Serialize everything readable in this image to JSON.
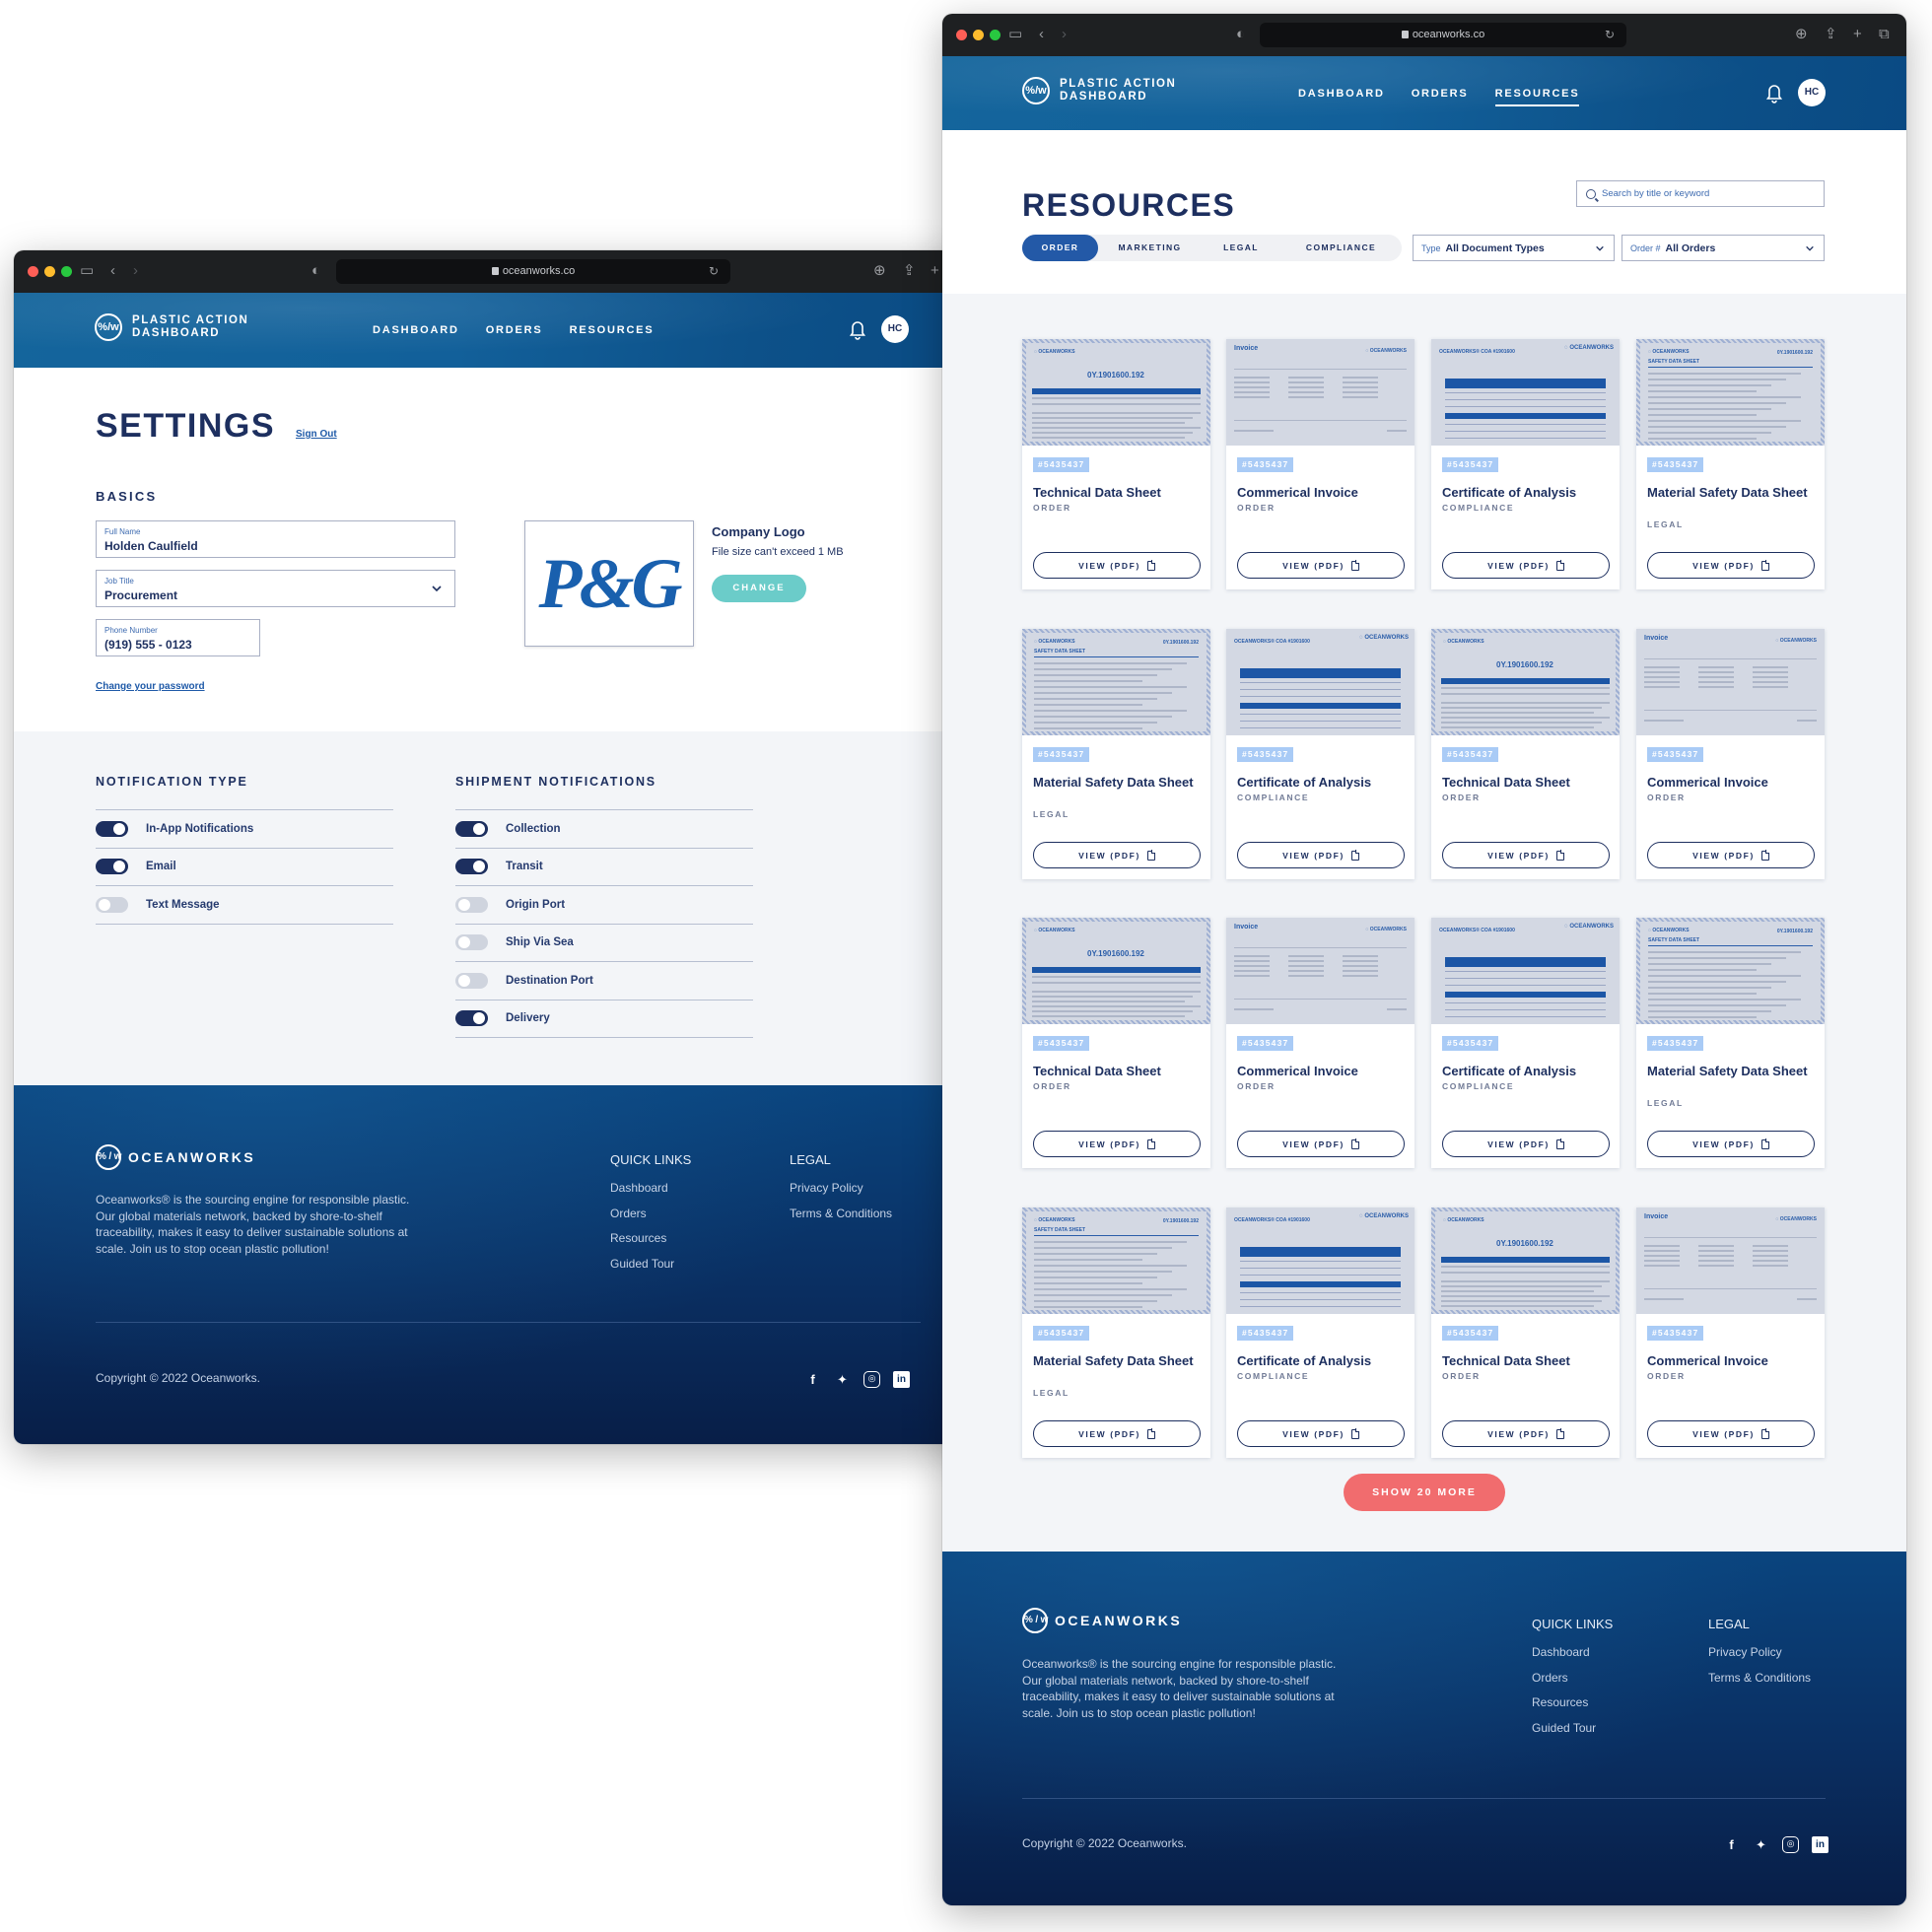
{
  "browser": {
    "url": "oceanworks.co"
  },
  "site": {
    "brand_mark": "%/w",
    "brand_title": "PLASTIC ACTION DASHBOARD",
    "nav": [
      {
        "label": "DASHBOARD"
      },
      {
        "label": "ORDERS"
      },
      {
        "label": "RESOURCES"
      }
    ],
    "avatar_initials": "HC"
  },
  "settings": {
    "title": "SETTINGS",
    "sign_out": "Sign Out",
    "basics_heading": "BASICS",
    "full_name": {
      "label": "Full Name",
      "value": "Holden Caulfield"
    },
    "job_title": {
      "label": "Job Title",
      "value": "Procurement"
    },
    "phone": {
      "label": "Phone Number",
      "value": "(919) 555 - 0123"
    },
    "change_password": "Change your password",
    "company_logo": {
      "title": "Company Logo",
      "note": "File size can't exceed 1 MB",
      "logo_text": "P&G",
      "change_label": "CHANGE"
    },
    "notification_type": {
      "heading": "NOTIFICATION TYPE",
      "items": [
        {
          "label": "In-App Notifications",
          "on": true
        },
        {
          "label": "Email",
          "on": true
        },
        {
          "label": "Text Message",
          "on": false
        }
      ]
    },
    "shipment_notifications": {
      "heading": "SHIPMENT  NOTIFICATIONS",
      "items": [
        {
          "label": "Collection",
          "on": true
        },
        {
          "label": "Transit",
          "on": true
        },
        {
          "label": "Origin Port",
          "on": false
        },
        {
          "label": "Ship Via Sea",
          "on": false
        },
        {
          "label": "Destination Port",
          "on": false
        },
        {
          "label": "Delivery",
          "on": true
        }
      ]
    }
  },
  "resources": {
    "title": "RESOURCES",
    "search_placeholder": "Search by title or keyword",
    "tabs": [
      {
        "label": "ORDER",
        "active": true
      },
      {
        "label": "MARKETING",
        "active": false
      },
      {
        "label": "LEGAL",
        "active": false
      },
      {
        "label": "COMPLIANCE",
        "active": false
      }
    ],
    "type_filter": {
      "key": "Type",
      "value": "All Document Types"
    },
    "order_filter": {
      "key": "Order #",
      "value": "All Orders"
    },
    "view_label": "VIEW (PDF)",
    "cards": [
      {
        "order": "#5435437",
        "title": "Technical Data Sheet",
        "category": "ORDER",
        "thumb": "tds"
      },
      {
        "order": "#5435437",
        "title": "Commerical Invoice",
        "category": "ORDER",
        "thumb": "invoice"
      },
      {
        "order": "#5435437",
        "title": "Certificate of Analysis",
        "category": "COMPLIANCE",
        "thumb": "coa"
      },
      {
        "order": "#5435437",
        "title": "Material Safety Data Sheet",
        "category": "LEGAL",
        "thumb": "msds"
      },
      {
        "order": "#5435437",
        "title": "Material Safety Data Sheet",
        "category": "LEGAL",
        "thumb": "msds"
      },
      {
        "order": "#5435437",
        "title": "Certificate of Analysis",
        "category": "COMPLIANCE",
        "thumb": "coa"
      },
      {
        "order": "#5435437",
        "title": "Technical Data Sheet",
        "category": "ORDER",
        "thumb": "tds"
      },
      {
        "order": "#5435437",
        "title": "Commerical Invoice",
        "category": "ORDER",
        "thumb": "invoice"
      },
      {
        "order": "#5435437",
        "title": "Technical Data Sheet",
        "category": "ORDER",
        "thumb": "tds"
      },
      {
        "order": "#5435437",
        "title": "Commerical Invoice",
        "category": "ORDER",
        "thumb": "invoice"
      },
      {
        "order": "#5435437",
        "title": "Certificate of Analysis",
        "category": "COMPLIANCE",
        "thumb": "coa"
      },
      {
        "order": "#5435437",
        "title": "Material Safety Data Sheet",
        "category": "LEGAL",
        "thumb": "msds"
      },
      {
        "order": "#5435437",
        "title": "Material Safety Data Sheet",
        "category": "LEGAL",
        "thumb": "msds"
      },
      {
        "order": "#5435437",
        "title": "Certificate of Analysis",
        "category": "COMPLIANCE",
        "thumb": "coa"
      },
      {
        "order": "#5435437",
        "title": "Technical Data Sheet",
        "category": "ORDER",
        "thumb": "tds"
      },
      {
        "order": "#5435437",
        "title": "Commerical Invoice",
        "category": "ORDER",
        "thumb": "invoice"
      }
    ],
    "show_more": "SHOW 20 MORE"
  },
  "thumb_text": {
    "oceanworks": "OCEANWORKS",
    "tds_code": "0Y.1901600.192",
    "invoice": "Invoice",
    "coa_heading": "OCEANWORKS® COA #1901600",
    "msds_heading": "SAFETY DATA SHEET"
  },
  "footer": {
    "brand": "OCEANWORKS",
    "description": "Oceanworks® is the sourcing engine for responsible plastic. Our global materials network, backed by shore-to-shelf traceability, makes it easy to deliver sustainable solutions at scale. Join us to stop ocean plastic pollution!",
    "quick_links_heading": "QUICK LINKS",
    "quick_links": [
      "Dashboard",
      "Orders",
      "Resources",
      "Guided Tour"
    ],
    "legal_heading": "LEGAL",
    "legal_links": [
      "Privacy Policy",
      "Terms & Conditions"
    ],
    "copyright": "Copyright © 2022 Oceanworks.",
    "social": [
      "facebook",
      "twitter",
      "instagram",
      "linkedin"
    ]
  },
  "colors": {
    "navy": "#1d2f5f",
    "accent_blue": "#2359a7",
    "teal": "#6bccc9",
    "coral": "#f16c6e",
    "badge": "#a9cbf6"
  }
}
